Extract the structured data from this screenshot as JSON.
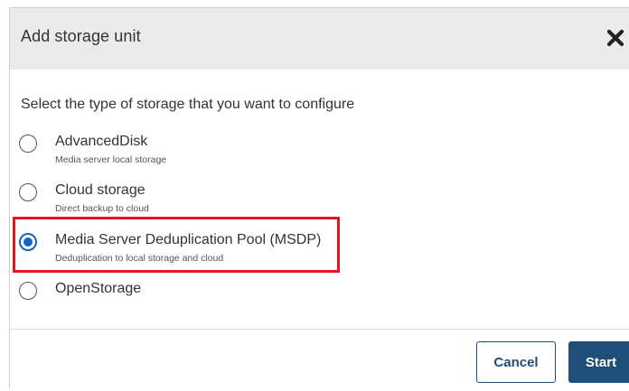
{
  "dialog": {
    "title": "Add storage unit",
    "close_icon": "close-icon"
  },
  "prompt": "Select the type of storage that you want to configure",
  "options": [
    {
      "label": "AdvancedDisk",
      "description": "Media server local storage",
      "selected": false
    },
    {
      "label": "Cloud storage",
      "description": "Direct backup to cloud",
      "selected": false
    },
    {
      "label": "Media Server Deduplication Pool (MSDP)",
      "description": "Deduplication to local storage and cloud",
      "selected": true
    },
    {
      "label": "OpenStorage",
      "description": "",
      "selected": false
    }
  ],
  "footer": {
    "cancel_label": "Cancel",
    "start_label": "Start"
  },
  "colors": {
    "accent": "#1565c0",
    "button_primary": "#1f4e79",
    "highlight": "#e8141b"
  }
}
